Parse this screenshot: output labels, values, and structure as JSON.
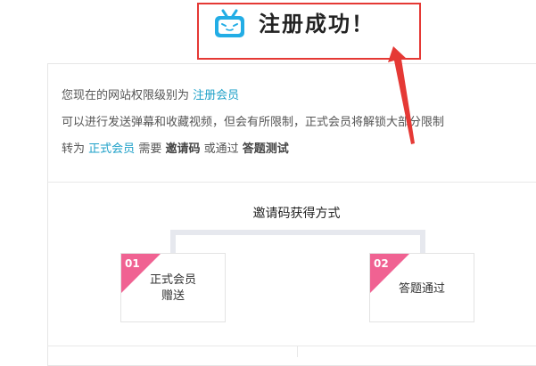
{
  "header": {
    "title": "注册成功！",
    "icon": "bilibili-tv-icon"
  },
  "info": {
    "line1_prefix": "您现在的网站权限级别为",
    "line1_level": "注册会员",
    "line2": "可以进行发送弹幕和收藏视频，但会有所限制，正式会员将解锁大部分限制",
    "line3_prefix": "转为",
    "line3_member": "正式会员",
    "line3_need": "需要",
    "line3_code": "邀请码",
    "line3_or": "或通过",
    "line3_quiz": "答题测试"
  },
  "invite": {
    "title": "邀请码获得方式",
    "methods": [
      {
        "number": "01",
        "label_line1": "正式会员",
        "label_line2": "赠送"
      },
      {
        "number": "02",
        "label": "答题通过"
      }
    ]
  },
  "colors": {
    "accent": "#1ea0c8",
    "highlight": "#e53935",
    "badge": "#f06292"
  }
}
